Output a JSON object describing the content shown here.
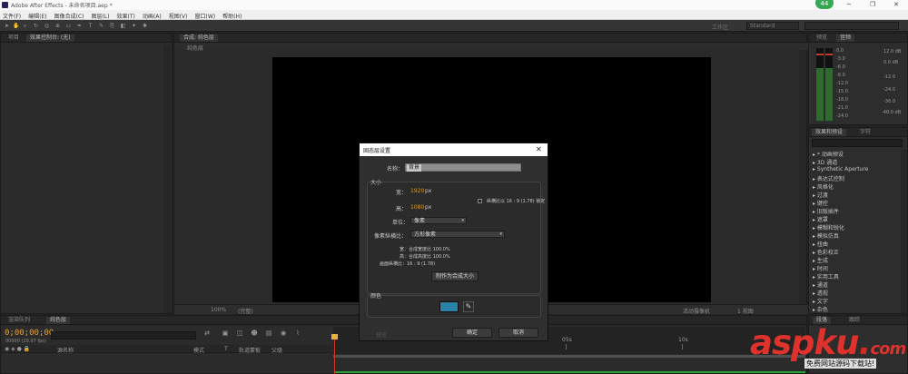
{
  "window": {
    "title": "Adobe After Effects - 未命名项目.aep *"
  },
  "notification_badge": "44",
  "menu": {
    "items": [
      "文件(F)",
      "编辑(E)",
      "图像合成(C)",
      "图层(L)",
      "效果(T)",
      "动画(A)",
      "视图(V)",
      "窗口(W)",
      "帮助(H)"
    ]
  },
  "toolbar": {
    "workspace_label": "工作区",
    "workspace_value": "Standard"
  },
  "project_panel": {
    "tab": "项目",
    "tab2": "效果控制台: (无)"
  },
  "comp_panel": {
    "tab": "合成: 纯色层",
    "subtab": "纯色层",
    "footer": [
      "100%",
      "(完整)",
      "活动摄像机",
      "1 视图"
    ]
  },
  "audio_panel": {
    "tab1": "预览",
    "tab2": "音频",
    "db_left": [
      "0.0",
      "-3.0",
      "-6.0",
      "-9.0",
      "-12.0",
      "-15.0",
      "-18.0",
      "-21.0",
      "-24.0"
    ],
    "db_right": [
      "12.0 dB",
      "0.0 dB",
      "-12.0",
      "-24.0",
      "-36.0",
      "-48.0 dB"
    ]
  },
  "effects_panel": {
    "tab1": "效果和预设",
    "tab2": "字符",
    "items": [
      "* 动画预设",
      "3D 通道",
      "Synthetic Aperture",
      "表达式控制",
      "风格化",
      "过渡",
      "键控",
      "旧版插件",
      "遮罩",
      "模糊和锐化",
      "模拟仿真",
      "扭曲",
      "色彩校正",
      "生成",
      "时间",
      "实用工具",
      "通道",
      "透视",
      "文字",
      "杂色"
    ]
  },
  "timeline": {
    "tab1": "渲染队列",
    "tab2": "纯色层",
    "timecode": "0;00;00;00",
    "framecode": "00000 (29.97 fps)",
    "columns": [
      "源名称",
      "模式",
      "T",
      "轨道蒙板",
      "父级"
    ],
    "ruler": [
      "05s",
      "10s"
    ]
  },
  "paragraph_panel": {
    "tab1": "段落",
    "tab2": "跟踪"
  },
  "dialog": {
    "title": "固态层设置",
    "name_label": "名称：",
    "name_value": "背景",
    "size_heading": "大小",
    "width_label": "宽：",
    "width_value": "1920",
    "width_unit": "px",
    "lock_label": "纵横比以 16 : 9 (1.78) 锁定",
    "height_label": "高：",
    "height_value": "1080",
    "height_unit": "px",
    "units_label": "单位：",
    "units_value": "像素",
    "pixel_aspect_label": "像素纵横比：",
    "pixel_aspect_value": "方形像素",
    "width_info": "宽：合成宽度比 100.0%",
    "height_info": "高：合成高度比 100.0%",
    "frame_aspect_info": "画面纵横比：16 : 9 (1.78)",
    "make_comp_size": "制作为合成大小",
    "color_heading": "颜色",
    "preview_label": "预览",
    "ok_label": "确定",
    "cancel_label": "取消",
    "swatch_color": "#2b82a8"
  },
  "watermark": {
    "main": "aspku",
    "dot": ".",
    "com": "com",
    "sub": "免费网站源码下载站!"
  }
}
